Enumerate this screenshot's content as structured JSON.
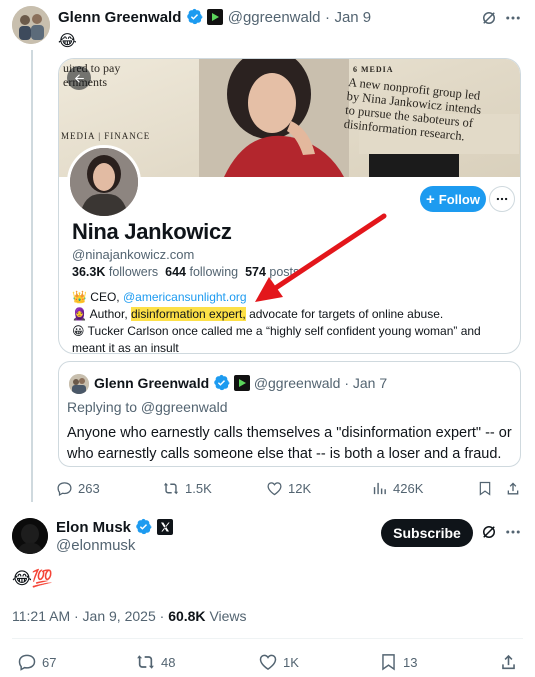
{
  "original_tweet": {
    "author_name": "Glenn Greenwald",
    "author_handle": "@ggreenwald",
    "date": "Jan 9",
    "text": "😂",
    "embedded_profile": {
      "banner_lines_left": [
        "uired to pay",
        "ernments",
        "MEDIA | FINANCE"
      ],
      "banner_heading": "6 MEDIA",
      "banner_lines_right": [
        "A new nonprofit group led",
        "by Nina Jankowicz intends",
        "to pursue the saboteurs of",
        "disinformation research."
      ],
      "follow_label": "Follow",
      "name": "Nina Jankowicz",
      "handle": "@ninajankowicz.com",
      "followers_count": "36.3K",
      "followers_label": "followers",
      "following_count": "644",
      "following_label": "following",
      "posts_count": "574",
      "posts_label": "posts",
      "bio_line1_prefix": "CEO,",
      "bio_line1_link": "@americansunlight.org",
      "bio_line2_prefix": "Author,",
      "bio_line2_highlight": "disinformation expert,",
      "bio_line2_suffix": "advocate for targets of online abuse.",
      "bio_line3": "Tucker Carlson once called me a “highly self confident young woman” and meant it as an insult",
      "bio_emoji_1": "👑",
      "bio_emoji_2": "🧕",
      "bio_emoji_3": "😀"
    },
    "quoted_tweet": {
      "author_name": "Glenn Greenwald",
      "author_handle": "@ggreenwald",
      "date": "Jan 7",
      "replying_to": "Replying to @ggreenwald",
      "text": "Anyone who earnestly calls themselves a \"disinformation expert\" -- or who earnestly calls someone else that -- is both a loser and a fraud."
    },
    "actions": {
      "replies": "263",
      "reposts": "1.5K",
      "likes": "12K",
      "views": "426K"
    }
  },
  "main_tweet": {
    "author_name": "Elon Musk",
    "author_handle": "@elonmusk",
    "subscribe_label": "Subscribe",
    "text": "😂💯",
    "timestamp": "11:21 AM · Jan 9, 2025",
    "views_count": "60.8K",
    "views_label": "Views",
    "actions": {
      "replies": "67",
      "reposts": "48",
      "likes": "1K",
      "bookmarks": "13"
    }
  },
  "colors": {
    "accent": "#1d9bf0",
    "verified": "#1d9bf0",
    "highlight": "#fde047",
    "arrow": "#e3161b",
    "secondary_text": "#536471"
  }
}
